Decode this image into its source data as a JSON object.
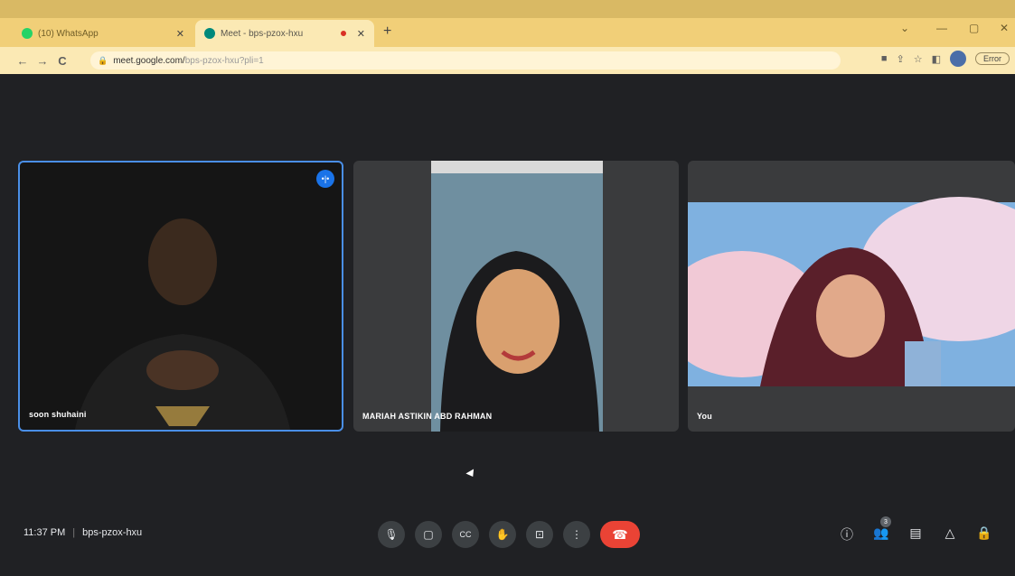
{
  "browser": {
    "tabs": [
      {
        "title": "(10) WhatsApp",
        "favicon_color": "#25d366",
        "active": false
      },
      {
        "title": "Meet - bps-pzox-hxu",
        "favicon_color": "#00897b",
        "active": true
      }
    ],
    "new_tab_symbol": "+",
    "window_controls": [
      "⌄",
      "—",
      "▢",
      "✕"
    ],
    "nav": {
      "back": "←",
      "forward": "→",
      "reload": "C"
    },
    "url_host": "meet.google.com/",
    "url_path": "bps-pzox-hxu?pli=1",
    "profile_button": "Error"
  },
  "participants": [
    {
      "name": "soon shuhaini",
      "speaking": true,
      "bg": "#151515"
    },
    {
      "name": "MARIAH ASTIKIN ABD RAHMAN",
      "speaking": false,
      "bg": "#3a3b3d"
    },
    {
      "name": "You",
      "speaking": false,
      "bg": "#3a3b3d"
    }
  ],
  "meeting": {
    "time": "11:37 PM",
    "separator": "|",
    "code": "bps-pzox-hxu",
    "people_count": "3"
  },
  "controls": {
    "mic": "🎙",
    "camera": "▢",
    "captions": "CC",
    "raise_hand": "✋",
    "present": "⊡",
    "more": "⋮",
    "end_call": "☎"
  },
  "right_controls": {
    "info": "ⓘ",
    "people": "👥",
    "chat": "▤",
    "activities": "△",
    "host": "🔒"
  },
  "colors": {
    "accent": "#1a73e8",
    "end_call": "#ea4335",
    "meet_bg": "#202124"
  }
}
